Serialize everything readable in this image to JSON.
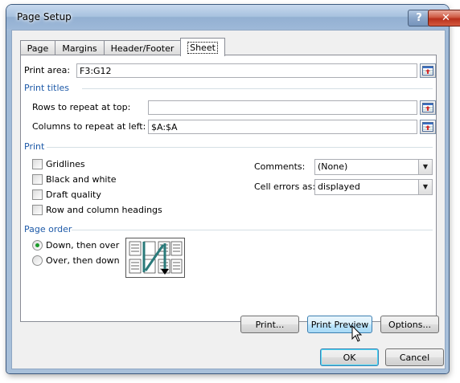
{
  "window": {
    "title": "Page Setup",
    "help_label": "?",
    "close_label": "✕"
  },
  "tabs": [
    {
      "label": "Page",
      "active": false
    },
    {
      "label": "Margins",
      "active": false
    },
    {
      "label": "Header/Footer",
      "active": false
    },
    {
      "label": "Sheet",
      "active": true
    }
  ],
  "print_area": {
    "label": "Print area:",
    "value": "F3:G12"
  },
  "print_titles": {
    "section_label": "Print titles",
    "rows_label": "Rows to repeat at top:",
    "rows_value": "",
    "cols_label": "Columns to repeat at left:",
    "cols_value": "$A:$A"
  },
  "print": {
    "section_label": "Print",
    "gridlines": {
      "label": "Gridlines",
      "checked": false
    },
    "black_white": {
      "label": "Black and white",
      "checked": false
    },
    "draft_quality": {
      "label": "Draft quality",
      "checked": false
    },
    "row_col_headings": {
      "label": "Row and column headings",
      "checked": false
    },
    "comments": {
      "label": "Comments:",
      "value": "(None)"
    },
    "cell_errors": {
      "label": "Cell errors as:",
      "value": "displayed"
    }
  },
  "page_order": {
    "section_label": "Page order",
    "down_then_over": {
      "label": "Down, then over",
      "selected": true
    },
    "over_then_down": {
      "label": "Over, then down",
      "selected": false
    }
  },
  "buttons": {
    "print": "Print...",
    "print_preview": "Print Preview",
    "options": "Options...",
    "ok": "OK",
    "cancel": "Cancel"
  },
  "colors": {
    "section_heading": "#1e5aa8",
    "page_order_arrow": "#2a7a7a"
  }
}
